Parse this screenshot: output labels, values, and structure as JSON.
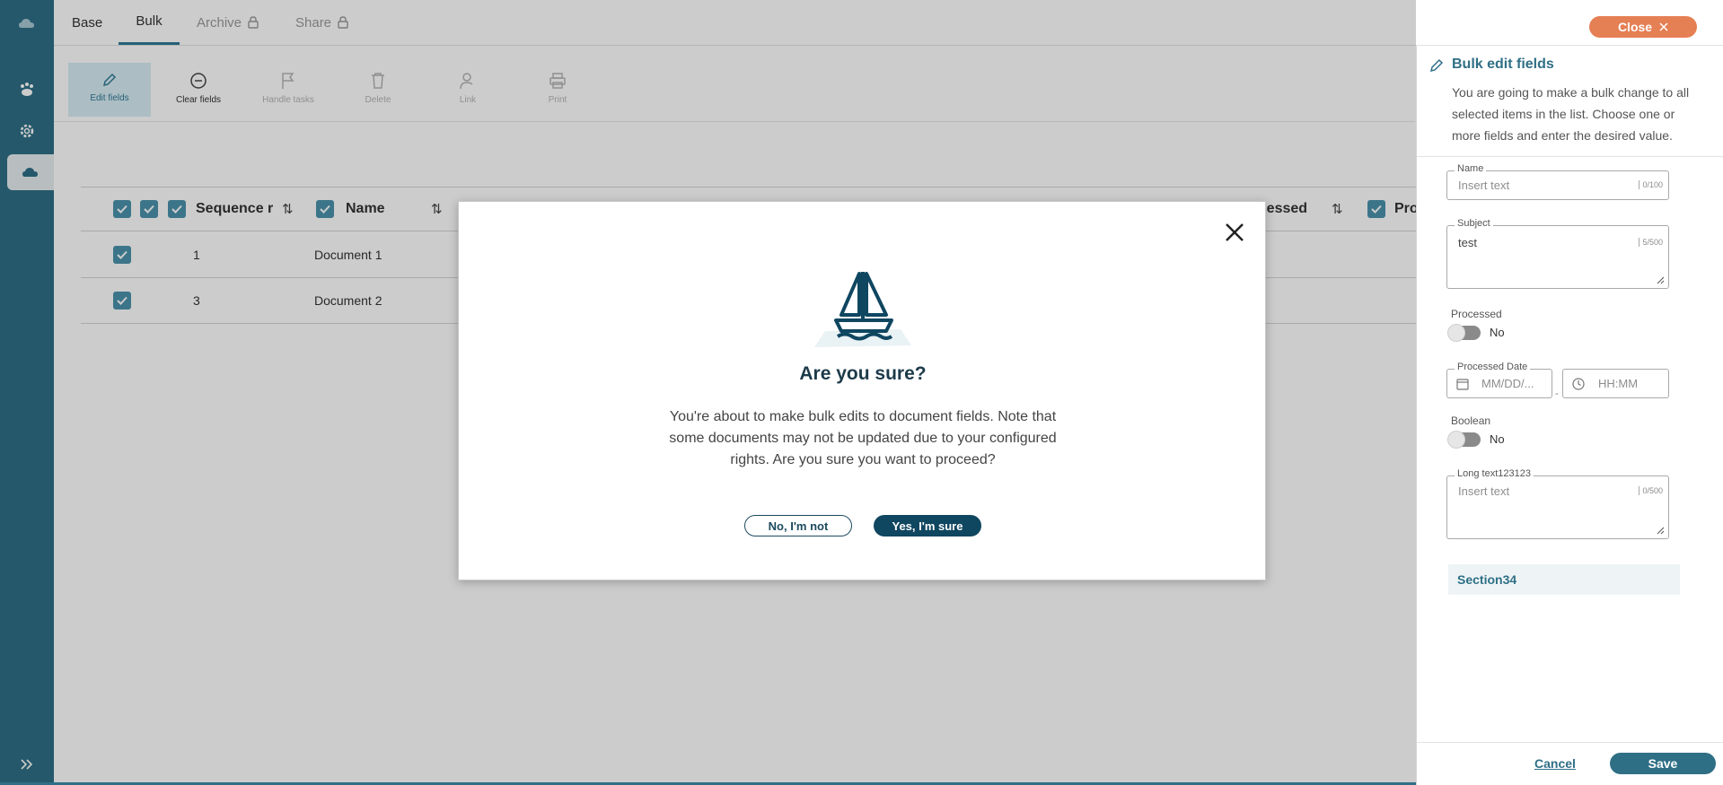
{
  "tabs": [
    {
      "label": "Base"
    },
    {
      "label": "Bulk"
    },
    {
      "label": "Archive"
    },
    {
      "label": "Share"
    }
  ],
  "close_button": "Close",
  "toolbar": [
    {
      "label": "Edit fields",
      "icon": "pencil-icon"
    },
    {
      "label": "Clear fields",
      "icon": "minus-circle-icon"
    },
    {
      "label": "Handle tasks",
      "icon": "flag-icon"
    },
    {
      "label": "Delete",
      "icon": "trash-icon"
    },
    {
      "label": "Link",
      "icon": "person-link-icon"
    },
    {
      "label": "Print",
      "icon": "printer-icon"
    }
  ],
  "table": {
    "headers": [
      "Sequence r",
      "Name",
      "ocessed",
      "Pro"
    ],
    "rows": [
      {
        "sequence": "1",
        "name": "Document 1"
      },
      {
        "sequence": "3",
        "name": "Document 2"
      }
    ]
  },
  "panel": {
    "title": "Bulk edit fields",
    "description": "You are going to make a bulk change to all selected items in the list. Choose one or more fields and enter the desired value.",
    "name_field": {
      "label": "Name",
      "placeholder": "Insert text",
      "count": "0/100"
    },
    "subject_field": {
      "label": "Subject",
      "value": "test",
      "count": "5/500"
    },
    "processed": {
      "label": "Processed",
      "state": "No"
    },
    "processed_date": {
      "label": "Processed Date",
      "date_placeholder": "MM/DD/...",
      "time_placeholder": "HH:MM",
      "separator": "-"
    },
    "boolean": {
      "label": "Boolean",
      "state": "No"
    },
    "long_text": {
      "label": "Long text123123",
      "placeholder": "Insert text",
      "count": "0/500"
    },
    "section": "Section34",
    "cancel": "Cancel",
    "save": "Save"
  },
  "modal": {
    "title": "Are you sure?",
    "body": "You're about to make bulk edits to document fields. Note that some documents may not be updated due to your configured rights. Are you sure you want to proceed?",
    "no_button": "No, I'm not",
    "yes_button": "Yes, I'm sure"
  },
  "colors": {
    "rail": "#2f6f86",
    "accent": "#2f7a96",
    "close_button": "#e57f54",
    "yes_button": "#0f4660"
  }
}
